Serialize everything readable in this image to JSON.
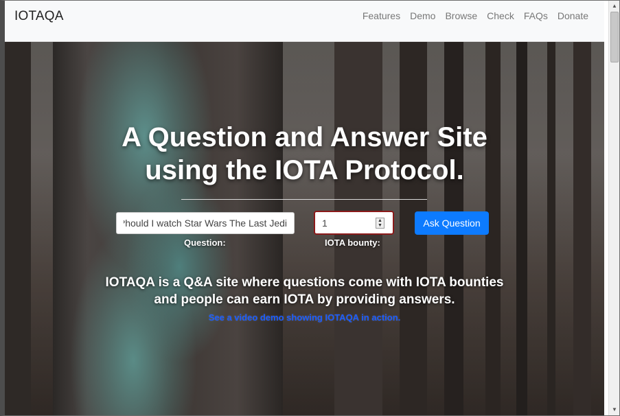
{
  "navbar": {
    "brand": "IOTAQA",
    "links": [
      "Features",
      "Demo",
      "Browse",
      "Check",
      "FAQs",
      "Donate"
    ]
  },
  "hero": {
    "headline_line1": "A Question and Answer Site",
    "headline_line2": "using the IOTA Protocol.",
    "question_input_value": "hould I watch Star Wars The Last Jedi?",
    "question_label": "Question:",
    "bounty_value": "1",
    "bounty_label": "IOTA bounty:",
    "ask_button": "Ask Question",
    "blurb_line1": "IOTAQA is a Q&A site where questions come with IOTA bounties",
    "blurb_line2": "and people can earn IOTA by providing answers.",
    "demo_link": "See a video demo showing IOTAQA in action."
  },
  "colors": {
    "accent": "#0d7bff",
    "bounty_border": "#8b1a1a",
    "link": "#1a5cff"
  },
  "icons": {
    "stepper": "number-stepper-icon",
    "scroll_up": "chevron-up-icon",
    "scroll_down": "chevron-down-icon"
  }
}
